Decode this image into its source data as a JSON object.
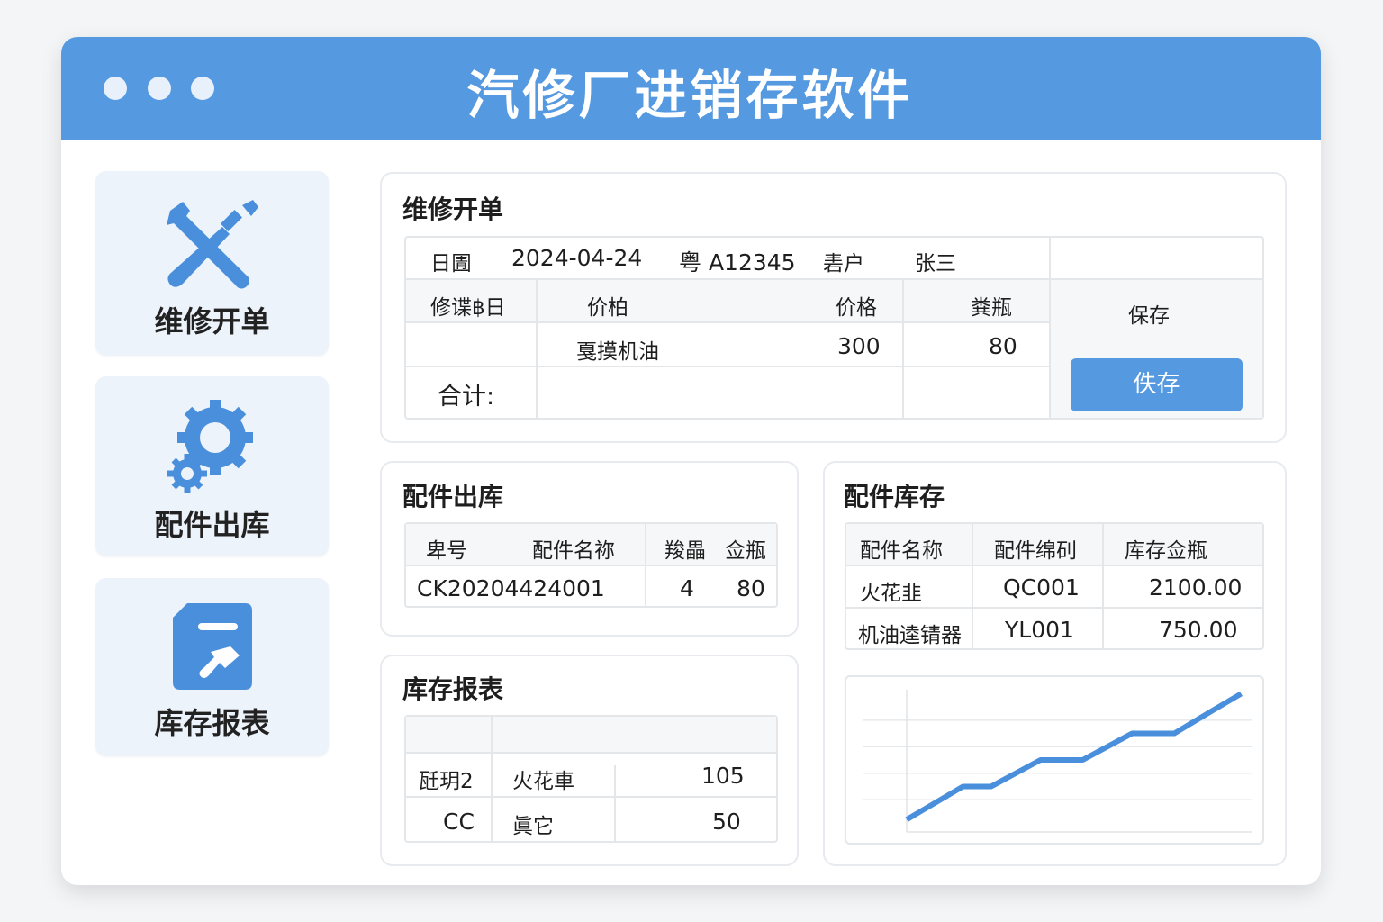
{
  "app": {
    "title": "汽修厂进销存软件"
  },
  "sidebar": {
    "items": [
      {
        "label": "维修开单",
        "icon": "wrench-screwdriver-icon"
      },
      {
        "label": "配件出库",
        "icon": "gears-icon"
      },
      {
        "label": "库存报表",
        "icon": "report-icon"
      }
    ]
  },
  "repair_order": {
    "title": "维修开单",
    "date_label": "日圊",
    "date": "2024-04-24",
    "plate": "粤 A12345",
    "customer_label": "砉户",
    "customer": "张三",
    "headers": [
      "修谍฿日",
      "价柏",
      "价格",
      "粪瓶"
    ],
    "rows": [
      [
        "",
        "戛摸机油",
        "300",
        "80"
      ]
    ],
    "total_label": "合计:",
    "save_text": "保存",
    "save_button": "佚存"
  },
  "parts_out": {
    "title": "配件出库",
    "headers": [
      "卑号",
      "配件名祢",
      "羧畾",
      "佥瓶"
    ],
    "rows": [
      [
        "CK20204424001",
        "",
        "4",
        "80"
      ]
    ]
  },
  "stock_report": {
    "title": "库存报表",
    "rows": [
      [
        "瓩玥2",
        "火花車",
        "105"
      ],
      [
        "CC",
        "眞它",
        "50"
      ]
    ]
  },
  "inventory": {
    "title": "配件库存",
    "headers": [
      "配件名称",
      "配件绵矵",
      "库存佥瓶"
    ],
    "rows": [
      [
        "火花韭",
        "QC001",
        "2100.00"
      ],
      [
        "机油逵锖器",
        "YL001",
        "750.00"
      ]
    ]
  },
  "chart_data": {
    "type": "line",
    "title": "",
    "xlabel": "",
    "ylabel": "",
    "xlim": [
      0,
      10
    ],
    "ylim": [
      0,
      5
    ],
    "grid": true,
    "x": [
      0,
      1.6,
      2.4,
      3.8,
      5.0,
      6.4,
      7.6,
      8.7,
      9.5
    ],
    "series": [
      {
        "name": "",
        "values": [
          0.7,
          1.7,
          1.7,
          2.5,
          2.5,
          3.3,
          3.3,
          4.0,
          4.5
        ]
      }
    ],
    "color": "#4a8fdc"
  }
}
